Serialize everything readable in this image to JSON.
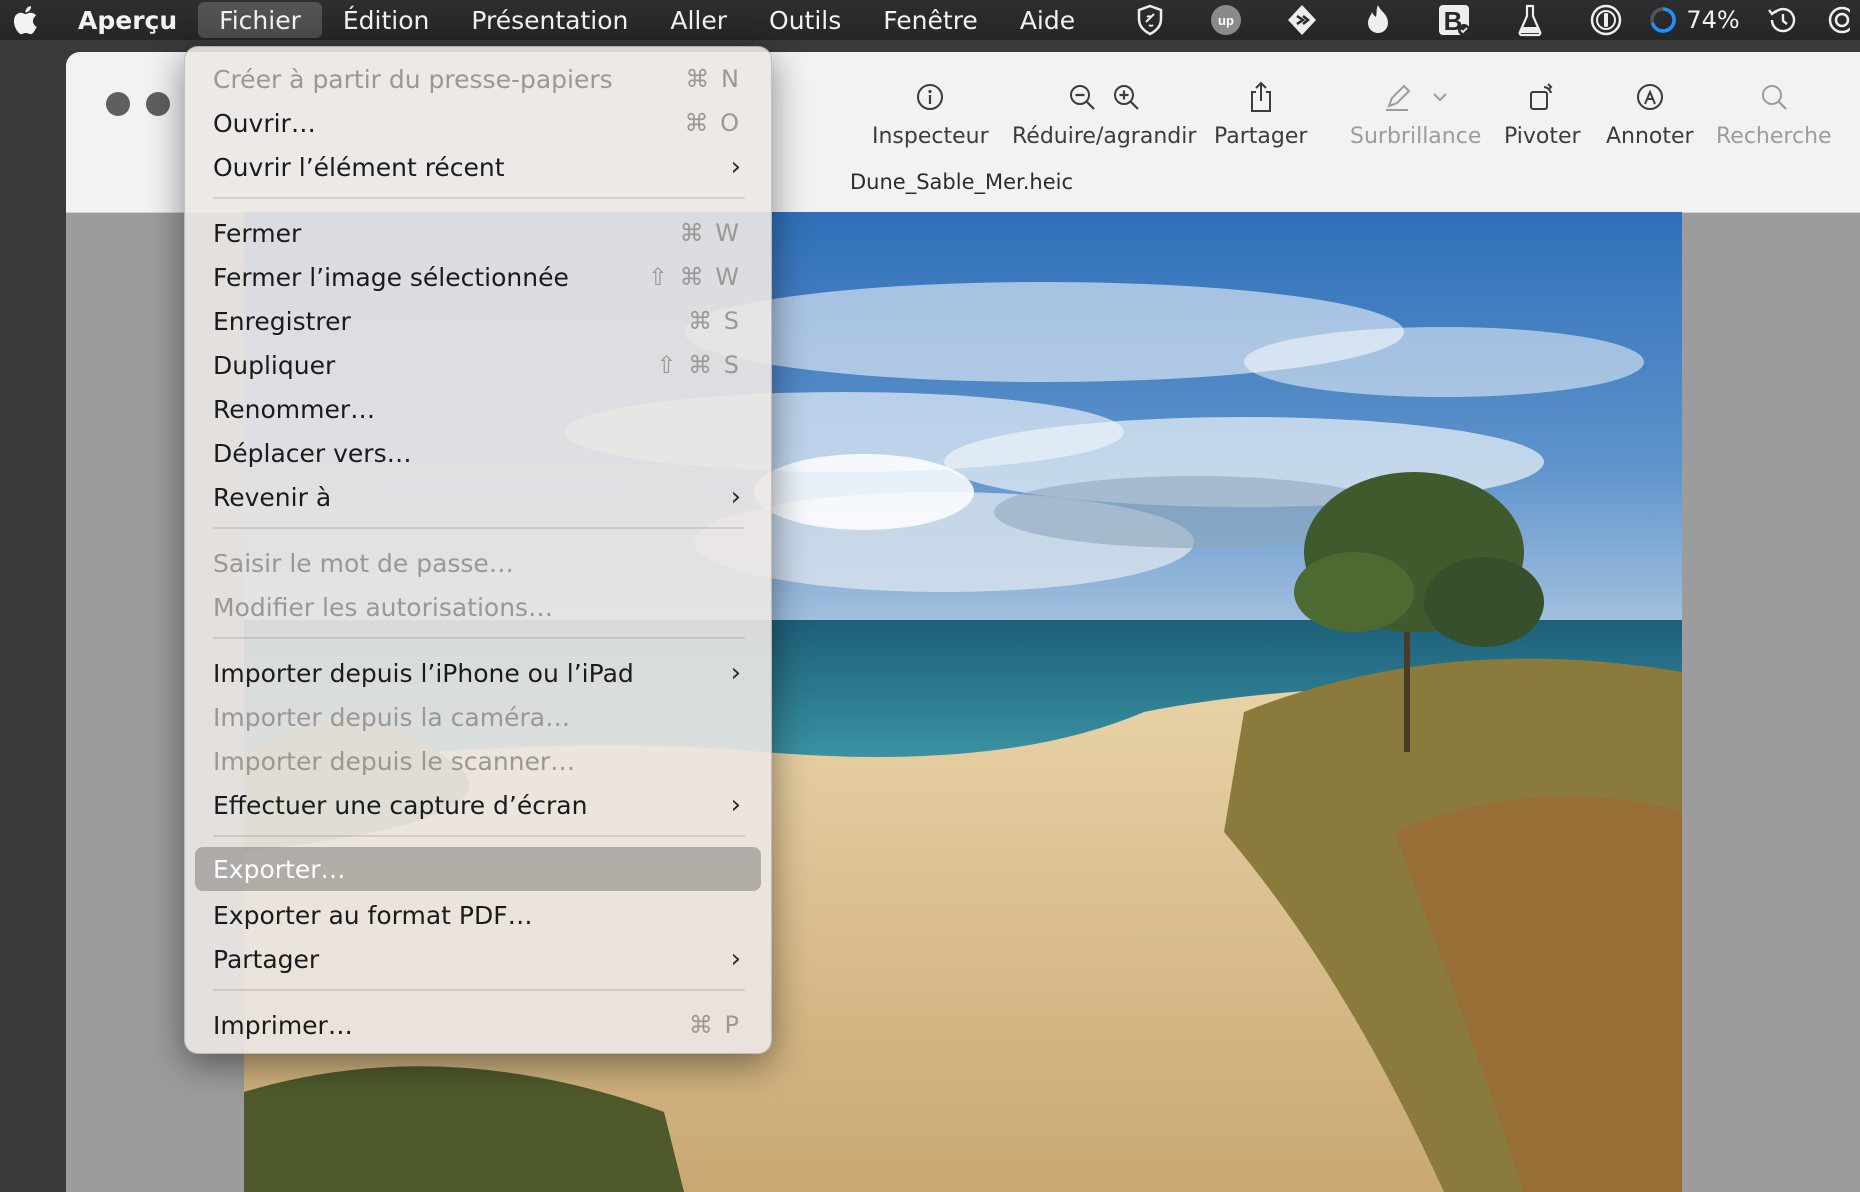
{
  "menubar": {
    "app_name": "Aperçu",
    "menus": [
      "Fichier",
      "Édition",
      "Présentation",
      "Aller",
      "Outils",
      "Fenêtre",
      "Aide"
    ],
    "active_menu": "Fichier",
    "battery_percent": "74%"
  },
  "toolbar": {
    "inspector_label": "Inspecteur",
    "zoom_label": "Réduire/agrandir",
    "share_label": "Partager",
    "highlight_label": "Surbrillance",
    "rotate_label": "Pivoter",
    "annotate_label": "Annoter",
    "search_label": "Recherche"
  },
  "document": {
    "title": "Dune_Sable_Mer.heic"
  },
  "file_menu": {
    "items": [
      {
        "label": "Créer à partir du presse-papiers",
        "shortcut": "⌘ N",
        "enabled": false
      },
      {
        "label": "Ouvrir…",
        "shortcut": "⌘ O",
        "enabled": true
      },
      {
        "label": "Ouvrir l’élément récent",
        "shortcut": "›",
        "enabled": true
      },
      {
        "label": "Fermer",
        "shortcut": "⌘ W",
        "enabled": true
      },
      {
        "label": "Fermer l’image sélectionnée",
        "shortcut": "⇧ ⌘ W",
        "enabled": true
      },
      {
        "label": "Enregistrer",
        "shortcut": "⌘ S",
        "enabled": true
      },
      {
        "label": "Dupliquer",
        "shortcut": "⇧ ⌘ S",
        "enabled": true
      },
      {
        "label": "Renommer…",
        "shortcut": "",
        "enabled": true
      },
      {
        "label": "Déplacer vers…",
        "shortcut": "",
        "enabled": true
      },
      {
        "label": "Revenir à",
        "shortcut": "›",
        "enabled": true
      },
      {
        "label": "Saisir le mot de passe…",
        "shortcut": "",
        "enabled": false
      },
      {
        "label": "Modifier les autorisations…",
        "shortcut": "",
        "enabled": false
      },
      {
        "label": "Importer depuis l’iPhone ou l’iPad",
        "shortcut": "›",
        "enabled": true
      },
      {
        "label": "Importer depuis la caméra…",
        "shortcut": "",
        "enabled": false
      },
      {
        "label": "Importer depuis le scanner…",
        "shortcut": "",
        "enabled": false
      },
      {
        "label": "Effectuer une capture d’écran",
        "shortcut": "›",
        "enabled": true
      },
      {
        "label": "Exporter…",
        "shortcut": "",
        "enabled": true,
        "selected": true
      },
      {
        "label": "Exporter au format PDF…",
        "shortcut": "",
        "enabled": true
      },
      {
        "label": "Partager",
        "shortcut": "›",
        "enabled": true
      },
      {
        "label": "Imprimer…",
        "shortcut": "⌘ P",
        "enabled": true
      }
    ]
  }
}
